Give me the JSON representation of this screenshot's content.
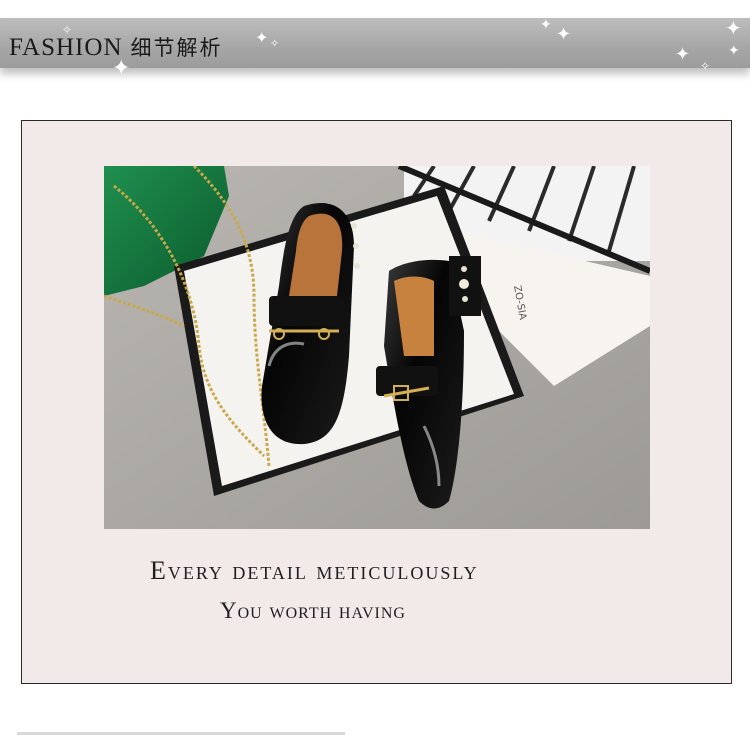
{
  "header": {
    "title_en": "FASHION",
    "title_cn": "细节解析",
    "sparkle_icon": "star-sparkle"
  },
  "content": {
    "caption_line1": "Every detail meticulously",
    "caption_line2": "You worth having"
  },
  "photo": {
    "box_text": "ZO-SIA"
  },
  "colors": {
    "banner": "#a6a6a6",
    "frame_bg": "#f2e9e9",
    "frame_border": "#2b2b2b",
    "text": "#1e1e1e"
  }
}
